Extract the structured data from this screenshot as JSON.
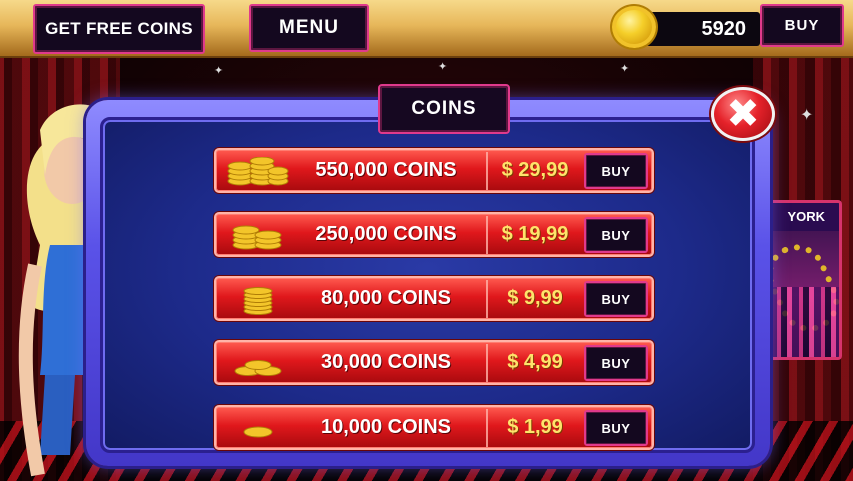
{
  "topbar": {
    "free_coins_label": "GET FREE COINS",
    "menu_label": "MENU",
    "balance": "5920",
    "buy_label": "BUY"
  },
  "modal": {
    "title": "COINS",
    "close_icon": "close-x-icon"
  },
  "side_card": {
    "label": "YORK"
  },
  "offers": [
    {
      "amount": "550,000 COINS",
      "price": "$ 29,99",
      "buy_label": "BUY",
      "icon": "coin-stack-large-icon"
    },
    {
      "amount": "250,000 COINS",
      "price": "$ 19,99",
      "buy_label": "BUY",
      "icon": "coin-stack-medium-icon"
    },
    {
      "amount": "80,000 COINS",
      "price": "$ 9,99",
      "buy_label": "BUY",
      "icon": "coin-stack-tall-icon"
    },
    {
      "amount": "30,000 COINS",
      "price": "$ 4,99",
      "buy_label": "BUY",
      "icon": "coin-pile-small-icon"
    },
    {
      "amount": "10,000 COINS",
      "price": "$ 1,99",
      "buy_label": "BUY",
      "icon": "single-coin-icon"
    }
  ],
  "colors": {
    "button_border": "#e03a8c",
    "button_bg": "#14081f",
    "row_red": "#e0181c",
    "price_gold": "#ffe36b",
    "modal_blue": "#1d2a8a"
  }
}
